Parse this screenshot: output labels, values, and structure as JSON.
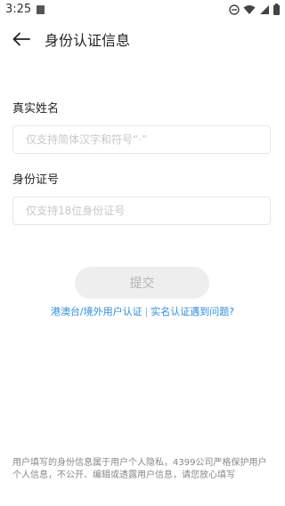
{
  "status_bar": {
    "time": "3:25"
  },
  "app_bar": {
    "title": "身份认证信息"
  },
  "form": {
    "name_label": "真实姓名",
    "name_placeholder": "仅支持简体汉字和符号“·”",
    "id_label": "身份证号",
    "id_placeholder": "仅支持18位身份证号",
    "submit_label": "提交"
  },
  "links": {
    "hk_macau_taiwan": "港澳台/境外用户认证",
    "separator": "|",
    "problem": "实名认证遇到问题?"
  },
  "footer": {
    "privacy_note": "用户填写的身份信息属于用户个人隐私，4399公司严格保护用户个人信息，不公开、编辑或透露用户信息，请您放心填写"
  },
  "colors": {
    "link": "#2c8ee0",
    "button_disabled_bg": "#eeeeee",
    "button_disabled_text": "#b4b4b4"
  }
}
